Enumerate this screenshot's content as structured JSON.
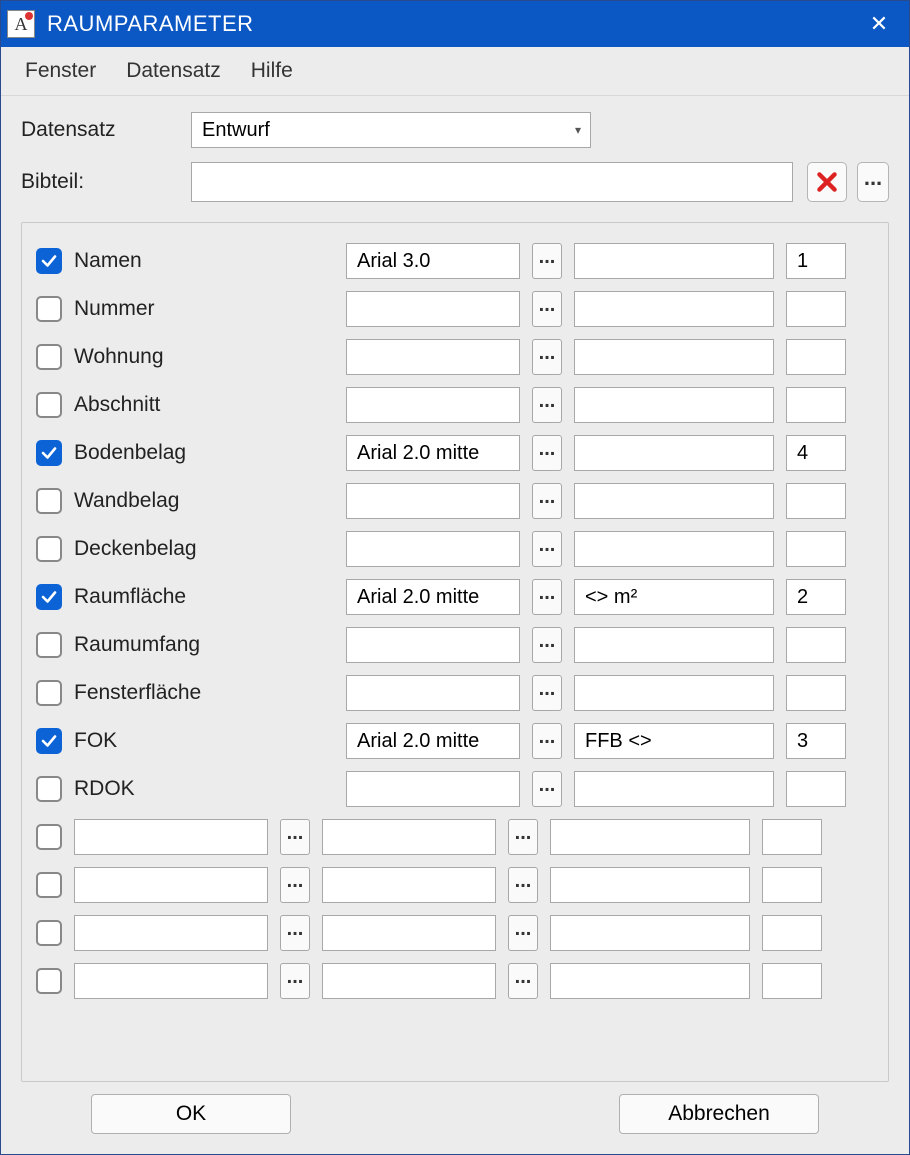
{
  "title": "RAUMPARAMETER",
  "menu": {
    "fenster": "Fenster",
    "datensatz": "Datensatz",
    "hilfe": "Hilfe"
  },
  "top": {
    "datensatz_label": "Datensatz",
    "datensatz_value": "Entwurf",
    "bibteil_label": "Bibteil:",
    "bibteil_value": ""
  },
  "params": [
    {
      "checked": true,
      "label": "Namen",
      "custom": false,
      "font": "Arial 3.0",
      "format": "",
      "order": "1"
    },
    {
      "checked": false,
      "label": "Nummer",
      "custom": false,
      "font": "",
      "format": "",
      "order": ""
    },
    {
      "checked": false,
      "label": "Wohnung",
      "custom": false,
      "font": "",
      "format": "",
      "order": ""
    },
    {
      "checked": false,
      "label": "Abschnitt",
      "custom": false,
      "font": "",
      "format": "",
      "order": ""
    },
    {
      "checked": true,
      "label": "Bodenbelag",
      "custom": false,
      "font": "Arial 2.0 mitte",
      "format": "",
      "order": "4"
    },
    {
      "checked": false,
      "label": "Wandbelag",
      "custom": false,
      "font": "",
      "format": "",
      "order": ""
    },
    {
      "checked": false,
      "label": "Deckenbelag",
      "custom": false,
      "font": "",
      "format": "",
      "order": ""
    },
    {
      "checked": true,
      "label": "Raumfläche",
      "custom": false,
      "font": "Arial 2.0 mitte",
      "format": "<> m²",
      "order": "2"
    },
    {
      "checked": false,
      "label": "Raumumfang",
      "custom": false,
      "font": "",
      "format": "",
      "order": ""
    },
    {
      "checked": false,
      "label": "Fensterfläche",
      "custom": false,
      "font": "",
      "format": "",
      "order": ""
    },
    {
      "checked": true,
      "label": "FOK",
      "custom": false,
      "font": "Arial 2.0 mitte",
      "format": "FFB <>",
      "order": "3"
    },
    {
      "checked": false,
      "label": "RDOK",
      "custom": false,
      "font": "",
      "format": "",
      "order": ""
    },
    {
      "checked": false,
      "label": "",
      "custom": true,
      "font": "",
      "format": "",
      "order": ""
    },
    {
      "checked": false,
      "label": "",
      "custom": true,
      "font": "",
      "format": "",
      "order": ""
    },
    {
      "checked": false,
      "label": "",
      "custom": true,
      "font": "",
      "format": "",
      "order": ""
    },
    {
      "checked": false,
      "label": "",
      "custom": true,
      "font": "",
      "format": "",
      "order": ""
    }
  ],
  "footer": {
    "ok": "OK",
    "cancel": "Abbrechen"
  }
}
